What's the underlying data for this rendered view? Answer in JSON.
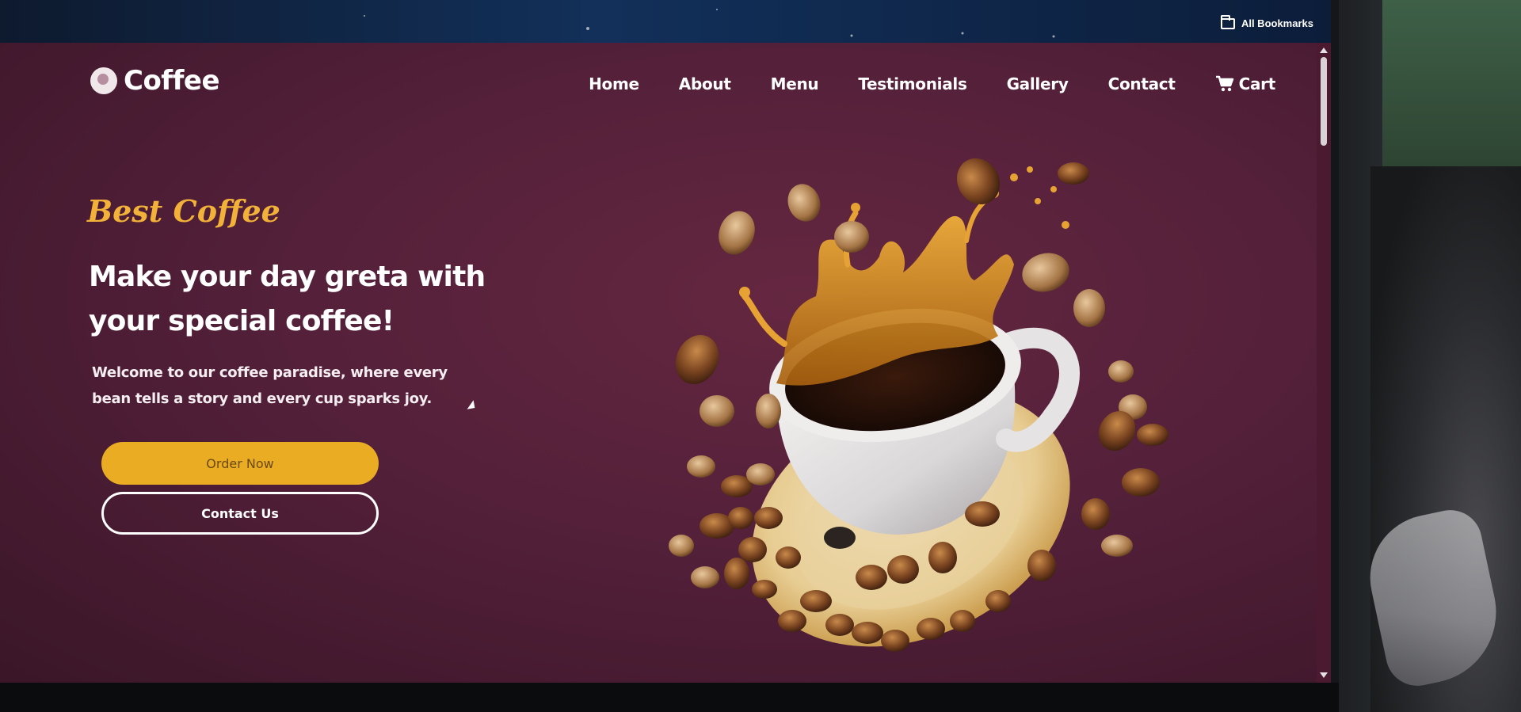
{
  "browser": {
    "bookmarks_label": "All Bookmarks"
  },
  "site": {
    "brand": "Coffee",
    "nav": [
      {
        "label": "Home"
      },
      {
        "label": "About"
      },
      {
        "label": "Menu"
      },
      {
        "label": "Testimonials"
      },
      {
        "label": "Gallery"
      },
      {
        "label": "Contact"
      },
      {
        "label": "Cart",
        "icon": "cart-icon"
      }
    ]
  },
  "hero": {
    "tagline": "Best Coffee",
    "headline": "Make your day greta with your special coffee!",
    "intro": "Welcome to our coffee paradise, where every bean tells a story and every cup sparks joy.",
    "primary_button": "Order Now",
    "secondary_button": "Contact Us",
    "image": "coffee-cup-splash-with-beans"
  },
  "colors": {
    "background": "#5a213c",
    "accent": "#e9ac23",
    "text": "#ffffff"
  }
}
